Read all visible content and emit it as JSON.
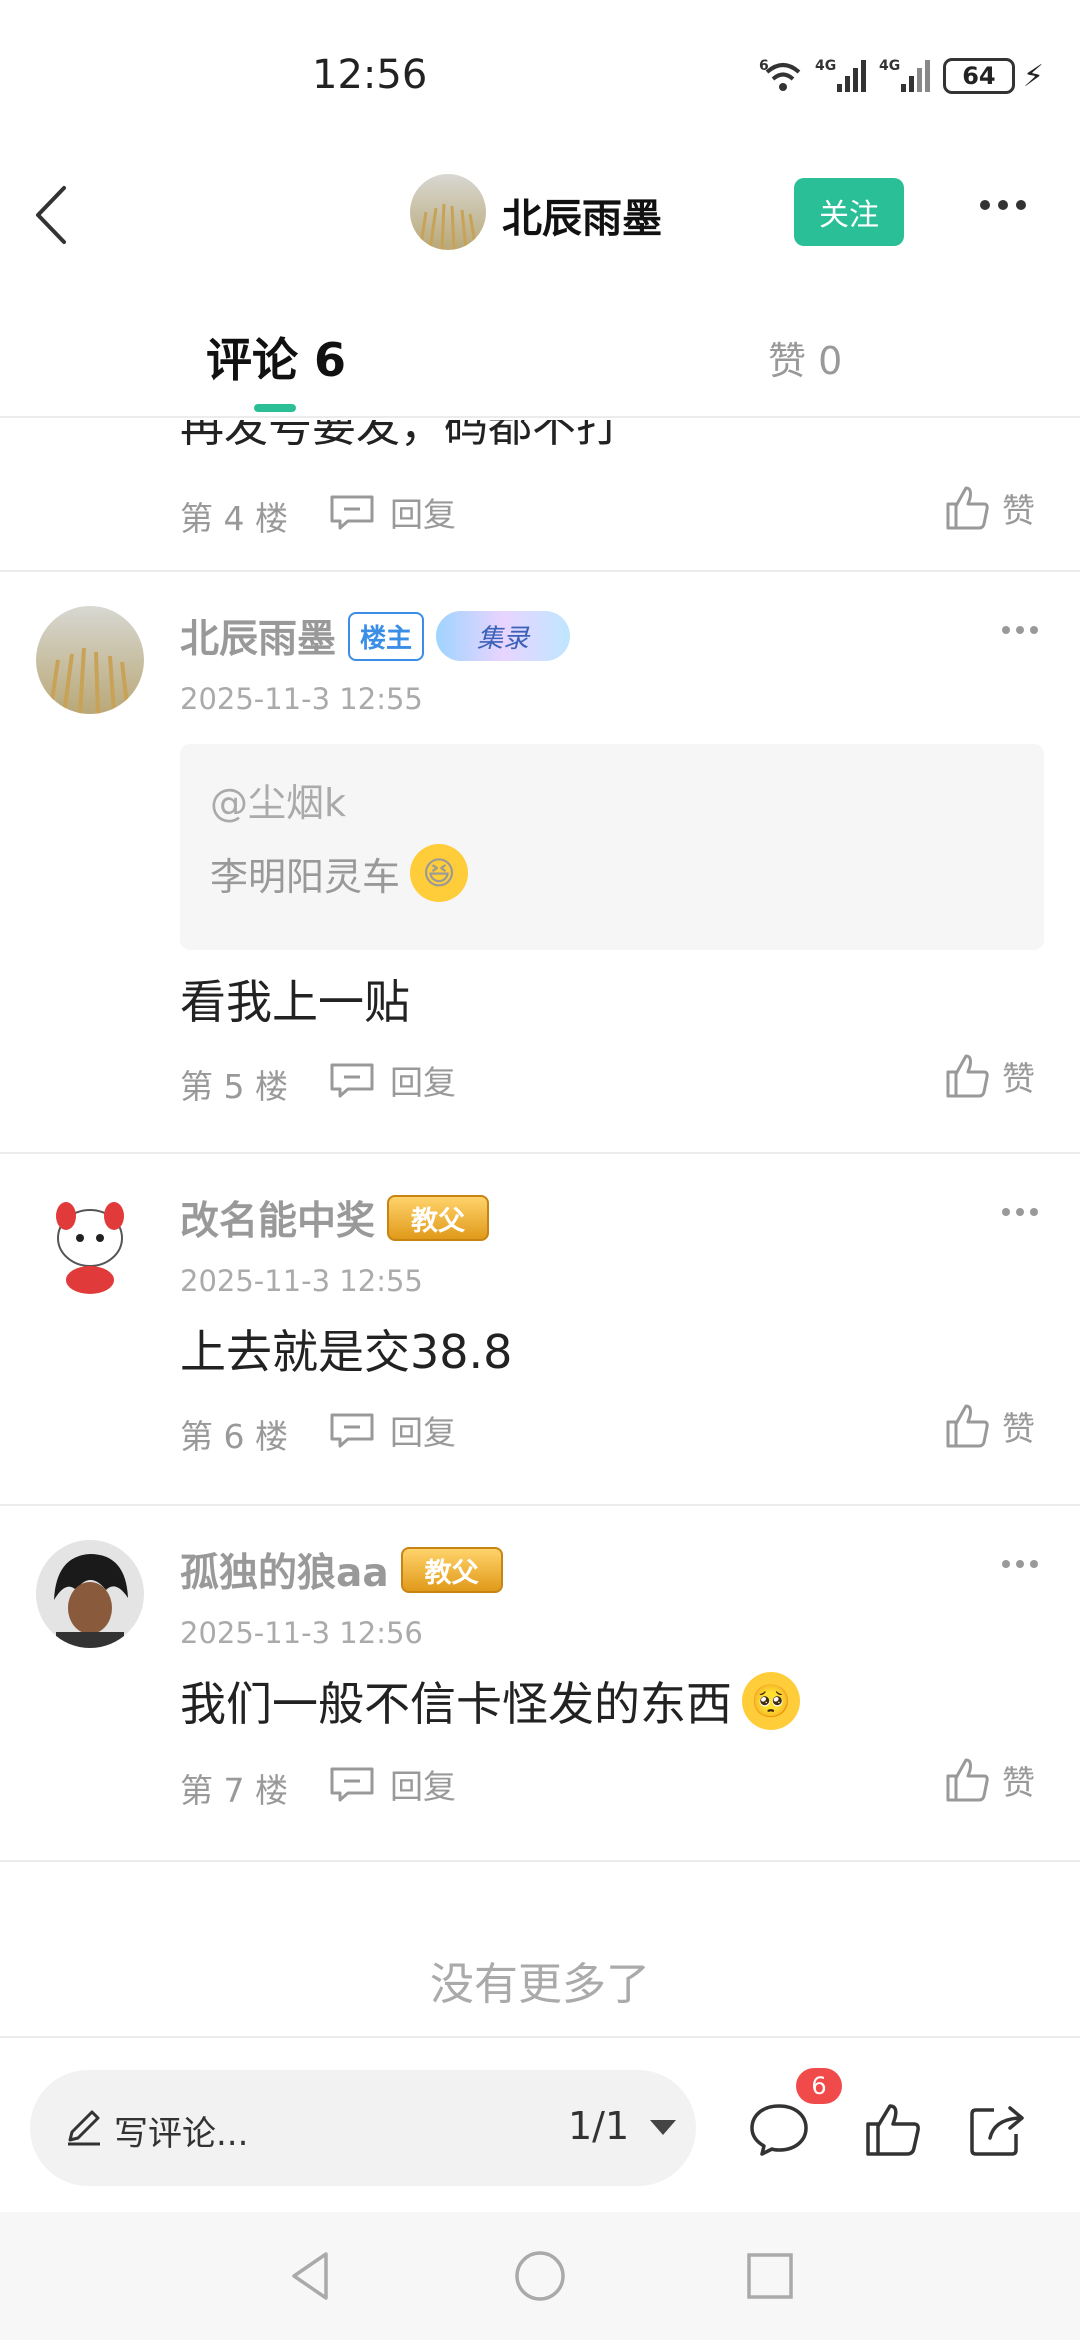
{
  "status_bar": {
    "time": "12:56",
    "signal_labels": [
      "6",
      "4G",
      "4G"
    ],
    "battery": "64",
    "icons": [
      "wifi-icon",
      "signal-icon",
      "battery-icon",
      "charging-icon"
    ]
  },
  "header": {
    "username": "北辰雨墨",
    "follow_label": "关注",
    "icons": [
      "back-icon",
      "more-icon"
    ]
  },
  "tabs": {
    "comments_label": "评论 6",
    "likes_label": "赞 0"
  },
  "feed": {
    "cut_off_text": "再发号要发，码都不打",
    "reply_label": "回复",
    "like_label": "赞",
    "comments": [
      {
        "floor": "第 4 楼"
      },
      {
        "username": "北辰雨墨",
        "host_badge": "楼主",
        "deco_badge": "集录",
        "timestamp": "2025-11-3 12:55",
        "quote": {
          "mention": "@尘烟k",
          "text": "李明阳灵车",
          "emoji": "laughing-tears"
        },
        "text": "看我上一贴",
        "floor": "第 5 楼"
      },
      {
        "username": "改名能中奖",
        "badge": "教父",
        "timestamp": "2025-11-3 12:55",
        "text": "上去就是交38.8",
        "floor": "第 6 楼"
      },
      {
        "username": "孤独的狼aa",
        "badge": "教父",
        "timestamp": "2025-11-3 12:56",
        "text": "我们一般不信卡怪发的东西",
        "emoji": "pleading-face",
        "floor": "第 7 楼"
      }
    ],
    "no_more": "没有更多了"
  },
  "bottom_bar": {
    "write_placeholder": "写评论...",
    "page_indicator": "1/1",
    "comment_count": "6",
    "icons": [
      "pen-icon",
      "comment-icon",
      "thumbs-up-icon",
      "share-icon"
    ]
  },
  "nav_bar": {
    "icons": [
      "nav-back-icon",
      "nav-home-icon",
      "nav-recents-icon"
    ]
  },
  "colors": {
    "accent": "#2bbf98",
    "host_badge": "#3a8ee6",
    "badge_red": "#f04a4a",
    "gold": "#e09a1a"
  }
}
